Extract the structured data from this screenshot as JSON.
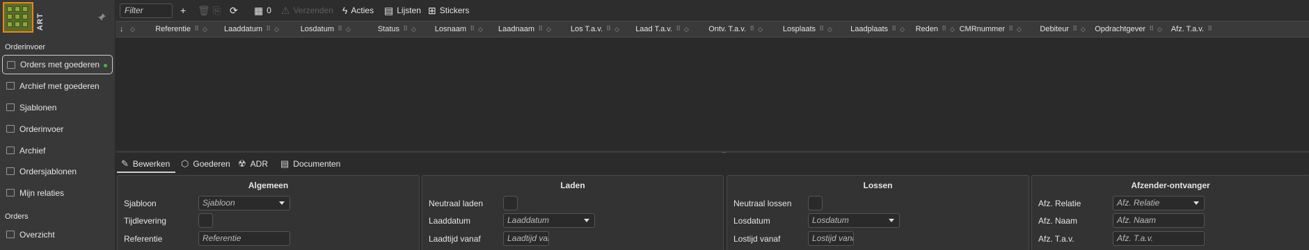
{
  "sidebar": {
    "logo_text": "ART",
    "sections": [
      {
        "label": "Orderinvoer"
      },
      {
        "label": "Orders"
      }
    ],
    "items": [
      {
        "label": "Orders met goederen"
      },
      {
        "label": "Archief met goederen"
      },
      {
        "label": "Sjablonen"
      },
      {
        "label": "Orderinvoer"
      },
      {
        "label": "Archief"
      },
      {
        "label": "Ordersjablonen"
      },
      {
        "label": "Mijn relaties"
      },
      {
        "label": "Overzicht"
      }
    ]
  },
  "toolbar": {
    "filter_placeholder": "Filter",
    "count": "0",
    "send_label": "Verzenden",
    "actions_label": "Acties",
    "lists_label": "Lijsten",
    "stickers_label": "Stickers"
  },
  "grid": {
    "columns": [
      "Referentie",
      "Laaddatum",
      "Losdatum",
      "Status",
      "Losnaam",
      "Laadnaam",
      "Los T.a.v.",
      "Laad T.a.v.",
      "Ontv. T.a.v.",
      "Losplaats",
      "Laadplaats",
      "Reden",
      "CMRnummer",
      "Debiteur",
      "Opdrachtgever",
      "Afz. T.a.v."
    ]
  },
  "tabs": [
    "Bewerken",
    "Goederen",
    "ADR",
    "Documenten"
  ],
  "panels": {
    "algemeen": {
      "title": "Algemeen",
      "sjabloon_label": "Sjabloon",
      "sjabloon_placeholder": "Sjabloon",
      "tijdlevering_label": "Tijdlevering",
      "referentie_label": "Referentie",
      "referentie_placeholder": "Referentie"
    },
    "laden": {
      "title": "Laden",
      "neutraal_label": "Neutraal laden",
      "datum_label": "Laaddatum",
      "datum_placeholder": "Laaddatum",
      "tijd_label": "Laadtijd vanaf",
      "tijd_placeholder": "Laadtijd var"
    },
    "lossen": {
      "title": "Lossen",
      "neutraal_label": "Neutraal lossen",
      "datum_label": "Losdatum",
      "datum_placeholder": "Losdatum",
      "tijd_label": "Lostijd vanaf",
      "tijd_placeholder": "Lostijd vanε"
    },
    "afzender": {
      "title": "Afzender-ontvanger",
      "relatie_label": "Afz. Relatie",
      "relatie_placeholder": "Afz. Relatie",
      "naam_label": "Afz. Naam",
      "naam_placeholder": "Afz. Naam",
      "tav_label": "Afz. T.a.v.",
      "tav_placeholder": "Afz. T.a.v."
    }
  }
}
